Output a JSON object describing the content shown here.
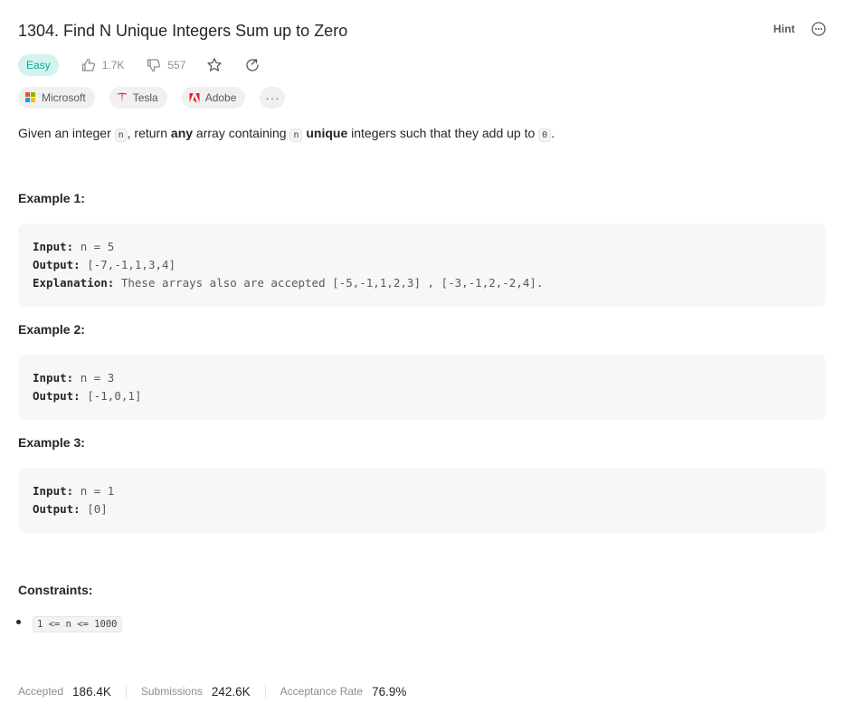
{
  "problem": {
    "title": "1304. Find N Unique Integers Sum up to Zero",
    "hint_label": "Hint",
    "difficulty": "Easy",
    "likes": "1.7K",
    "dislikes": "557"
  },
  "companies": [
    {
      "name": "Microsoft"
    },
    {
      "name": "Tesla"
    },
    {
      "name": "Adobe"
    }
  ],
  "more_tags_label": "···",
  "description": {
    "part1": "Given an integer ",
    "code_n": "n",
    "part2": ", return ",
    "bold_any": "any",
    "part3": " array containing ",
    "code_n2": "n",
    "part4": " ",
    "bold_unique": "unique",
    "part5": " integers such that they add up to ",
    "code_zero": "0",
    "part6": "."
  },
  "examples": [
    {
      "title": "Example 1:",
      "input_label": "Input:",
      "input": "n = 5",
      "output_label": "Output:",
      "output": "[-7,-1,1,3,4]",
      "explanation_label": "Explanation:",
      "explanation": "These arrays also are accepted [-5,-1,1,2,3] , [-3,-1,2,-2,4]."
    },
    {
      "title": "Example 2:",
      "input_label": "Input:",
      "input": "n = 3",
      "output_label": "Output:",
      "output": "[-1,0,1]"
    },
    {
      "title": "Example 3:",
      "input_label": "Input:",
      "input": "n = 1",
      "output_label": "Output:",
      "output": "[0]"
    }
  ],
  "constraints": {
    "title": "Constraints:",
    "items": [
      "1 <= n <= 1000"
    ]
  },
  "stats": {
    "accepted_label": "Accepted",
    "accepted": "186.4K",
    "submissions_label": "Submissions",
    "submissions": "242.6K",
    "rate_label": "Acceptance Rate",
    "rate": "76.9%"
  },
  "colors": {
    "easy": "#00af9b",
    "easy_bg": "#d3f3ee",
    "tesla": "#e82127",
    "adobe": "#ed1c24"
  },
  "icons": [
    "thumbs-up-icon",
    "thumbs-down-icon",
    "star-icon",
    "share-icon",
    "more-icon",
    "microsoft-logo",
    "tesla-logo",
    "adobe-logo"
  ]
}
